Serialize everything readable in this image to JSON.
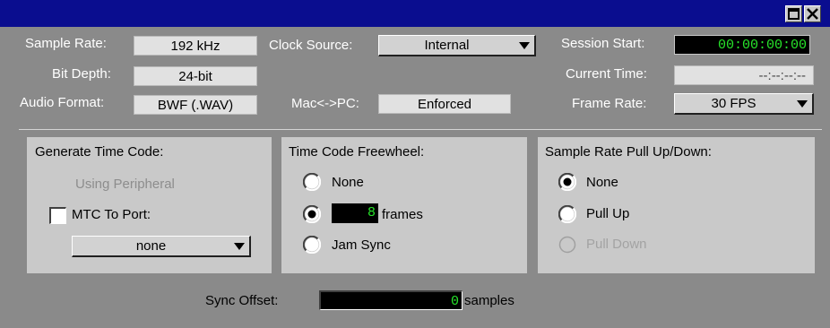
{
  "window": {
    "restore_icon": "restore-icon",
    "close_icon": "close-icon"
  },
  "session": {
    "sample_rate_label": "Sample Rate:",
    "sample_rate_value": "192 kHz",
    "bit_depth_label": "Bit Depth:",
    "bit_depth_value": "24-bit",
    "audio_format_label": "Audio Format:",
    "audio_format_value": "BWF (.WAV)",
    "clock_source_label": "Clock Source:",
    "clock_source_value": "Internal",
    "macpc_label": "Mac<->PC:",
    "macpc_value": "Enforced",
    "session_start_label": "Session Start:",
    "session_start_value": "00:00:00:00",
    "current_time_label": "Current Time:",
    "current_time_value": "--:--:--:--",
    "frame_rate_label": "Frame Rate:",
    "frame_rate_value": "30 FPS"
  },
  "generate_tc": {
    "title": "Generate Time Code:",
    "using_peripheral": "Using Peripheral",
    "mtc_label": "MTC To Port:",
    "mtc_checked": false,
    "port_value": "none"
  },
  "freewheel": {
    "title": "Time Code Freewheel:",
    "options": [
      {
        "label": "None",
        "selected": false
      },
      {
        "label": "frames",
        "selected": true
      },
      {
        "label": "Jam Sync",
        "selected": false
      }
    ],
    "frames_value": "8"
  },
  "pull": {
    "title": "Sample Rate Pull Up/Down:",
    "options": [
      {
        "label": "None",
        "selected": true,
        "enabled": true
      },
      {
        "label": "Pull Up",
        "selected": false,
        "enabled": true
      },
      {
        "label": "Pull Down",
        "selected": false,
        "enabled": false
      }
    ]
  },
  "sync": {
    "label": "Sync Offset:",
    "value": "0",
    "unit": "samples"
  },
  "colors": {
    "titlebar": "#0a0d8f",
    "background": "#8a8a8a",
    "panel": "#c9c9c9",
    "timecode_green": "#27e52a"
  }
}
